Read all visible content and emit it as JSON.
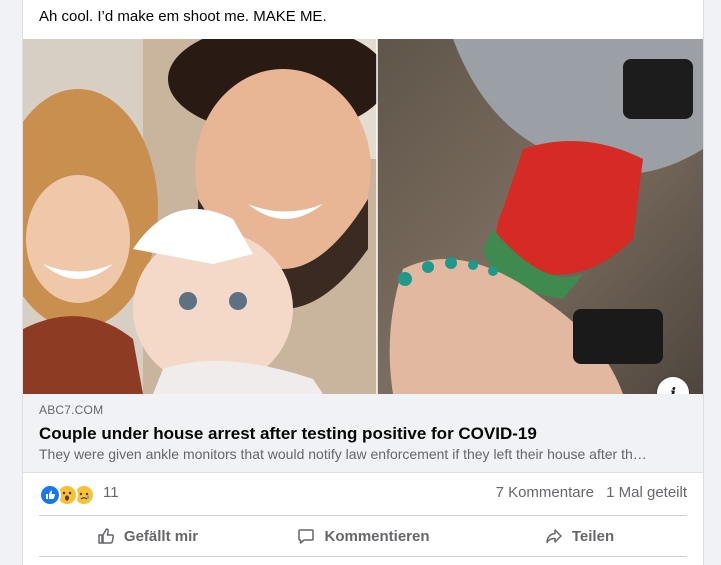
{
  "post": {
    "text": "Ah cool. I’d make em shoot me. MAKE ME."
  },
  "link_preview": {
    "domain": "ABC7.COM",
    "title": "Couple under house arrest after testing positive for COVID-19",
    "description": "They were given ankle monitors that would notify law enforcement if they left their house after th…",
    "info_icon": "info-icon"
  },
  "reactions": {
    "types": [
      "like",
      "wow",
      "sad"
    ],
    "count": "11",
    "comments": "7 Kommentare",
    "shares": "1 Mal geteilt"
  },
  "actions": {
    "like_label": "Gefällt mir",
    "comment_label": "Kommentieren",
    "share_label": "Teilen"
  },
  "colors": {
    "like_blue": "#1877f2",
    "reaction_yellow": "#f7c238",
    "secondary_text": "#65676b",
    "preview_bg": "#f0f2f5"
  }
}
